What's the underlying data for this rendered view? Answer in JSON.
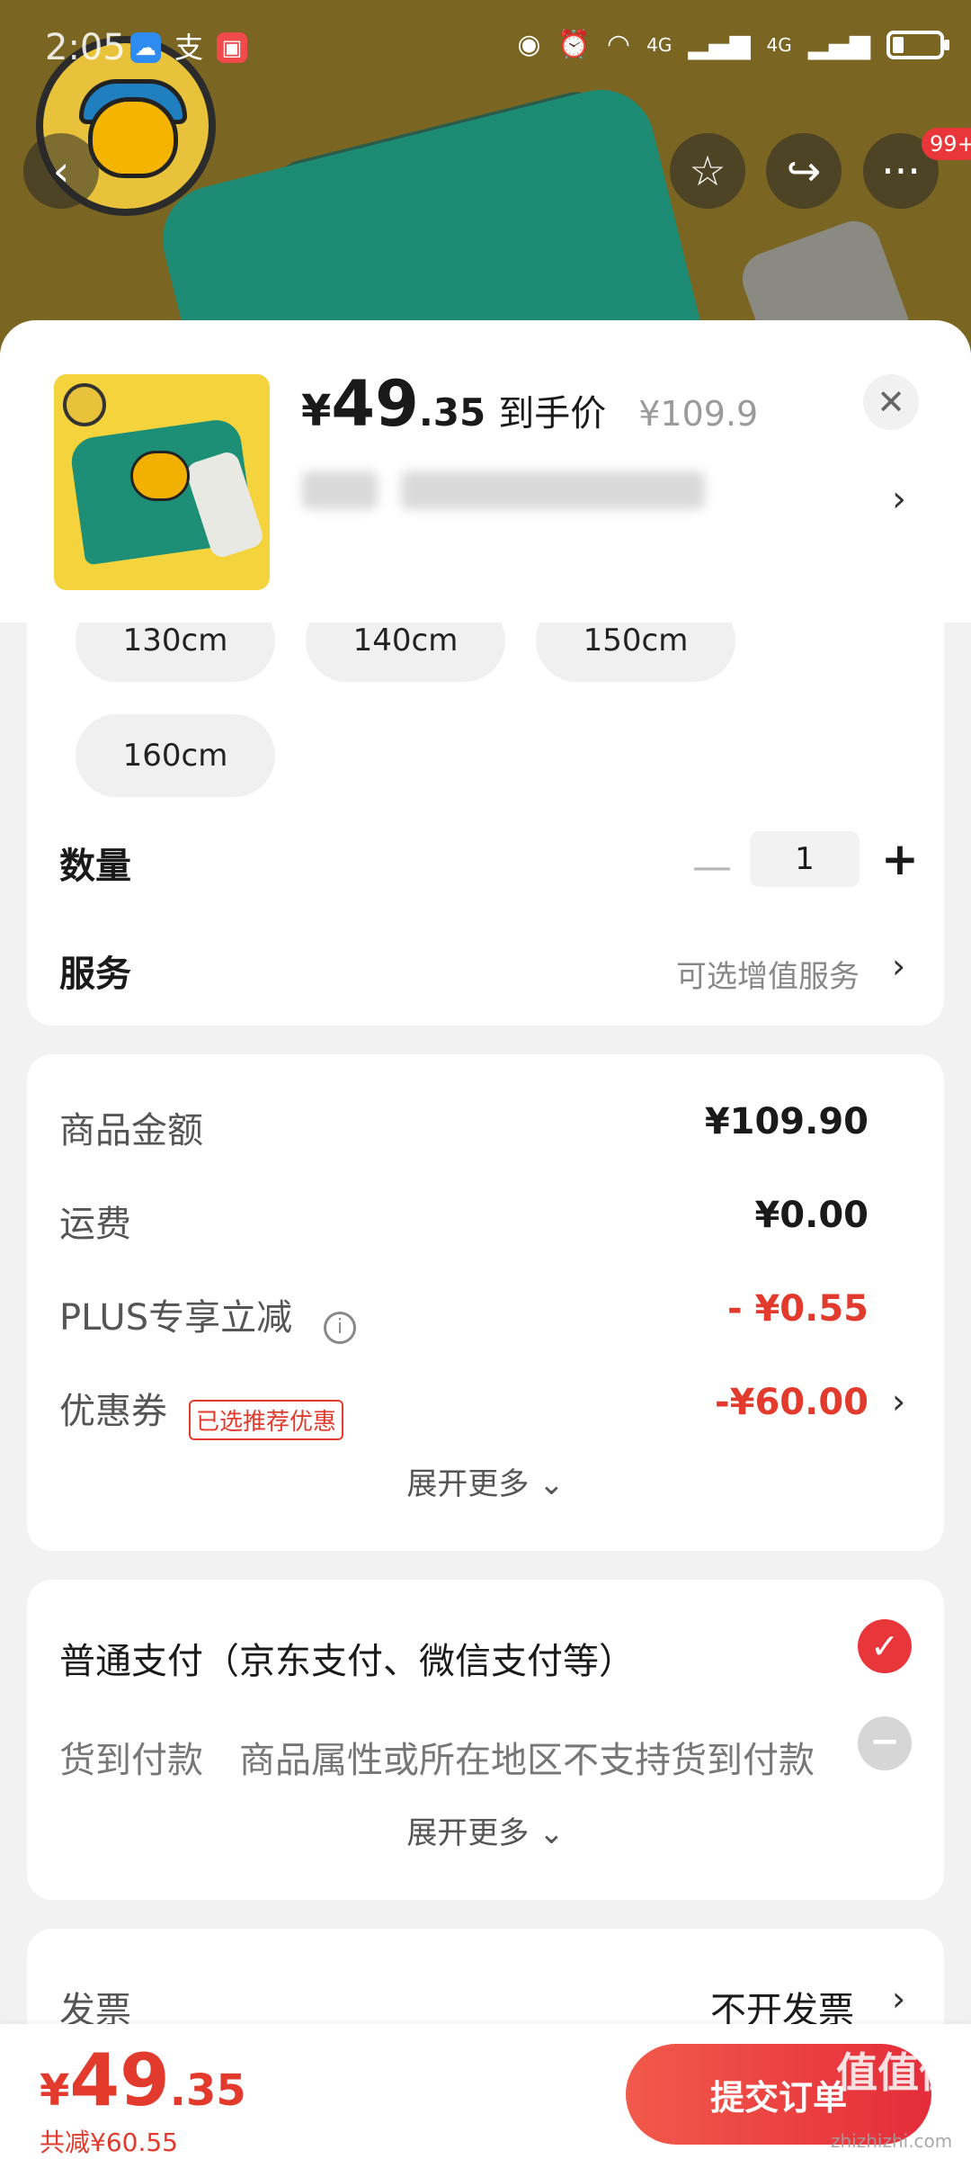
{
  "status_bar": {
    "time": "2:05",
    "network_left": "4G",
    "network_right": "4G"
  },
  "nav": {
    "more_badge": "99+"
  },
  "product": {
    "price_yen": "¥",
    "price_int": "49",
    "price_dec": ".35",
    "price_label": "到手价",
    "original_price": "¥109.9"
  },
  "sizes": [
    "130cm",
    "140cm",
    "150cm",
    "160cm"
  ],
  "quantity": {
    "label": "数量",
    "value": "1"
  },
  "service": {
    "label": "服务",
    "hint": "可选增值服务"
  },
  "amount": {
    "goods_label": "商品金额",
    "goods_value": "¥109.90",
    "shipping_label": "运费",
    "shipping_value": "¥0.00",
    "plus_label": "PLUS专享立减",
    "plus_value": "- ¥0.55",
    "coupon_label": "优惠券",
    "coupon_tag": "已选推荐优惠",
    "coupon_value": "-¥60.00",
    "expand": "展开更多"
  },
  "payment": {
    "normal": "普通支付（京东支付、微信支付等）",
    "cod_label": "货到付款",
    "cod_note": "商品属性或所在地区不支持货到付款",
    "expand": "展开更多"
  },
  "invoice": {
    "label": "发票",
    "value": "不开发票"
  },
  "bottom": {
    "yen": "¥",
    "int": "49",
    "dec": ".35",
    "saved": "共减¥60.55",
    "submit": "提交订单"
  },
  "watermark": {
    "main": "值值值",
    "sub": "zhizhizhi.com"
  },
  "colors": {
    "accent_red": "#e23a2d",
    "button_red": "#e42c3a",
    "product_bg": "#7a6523"
  }
}
